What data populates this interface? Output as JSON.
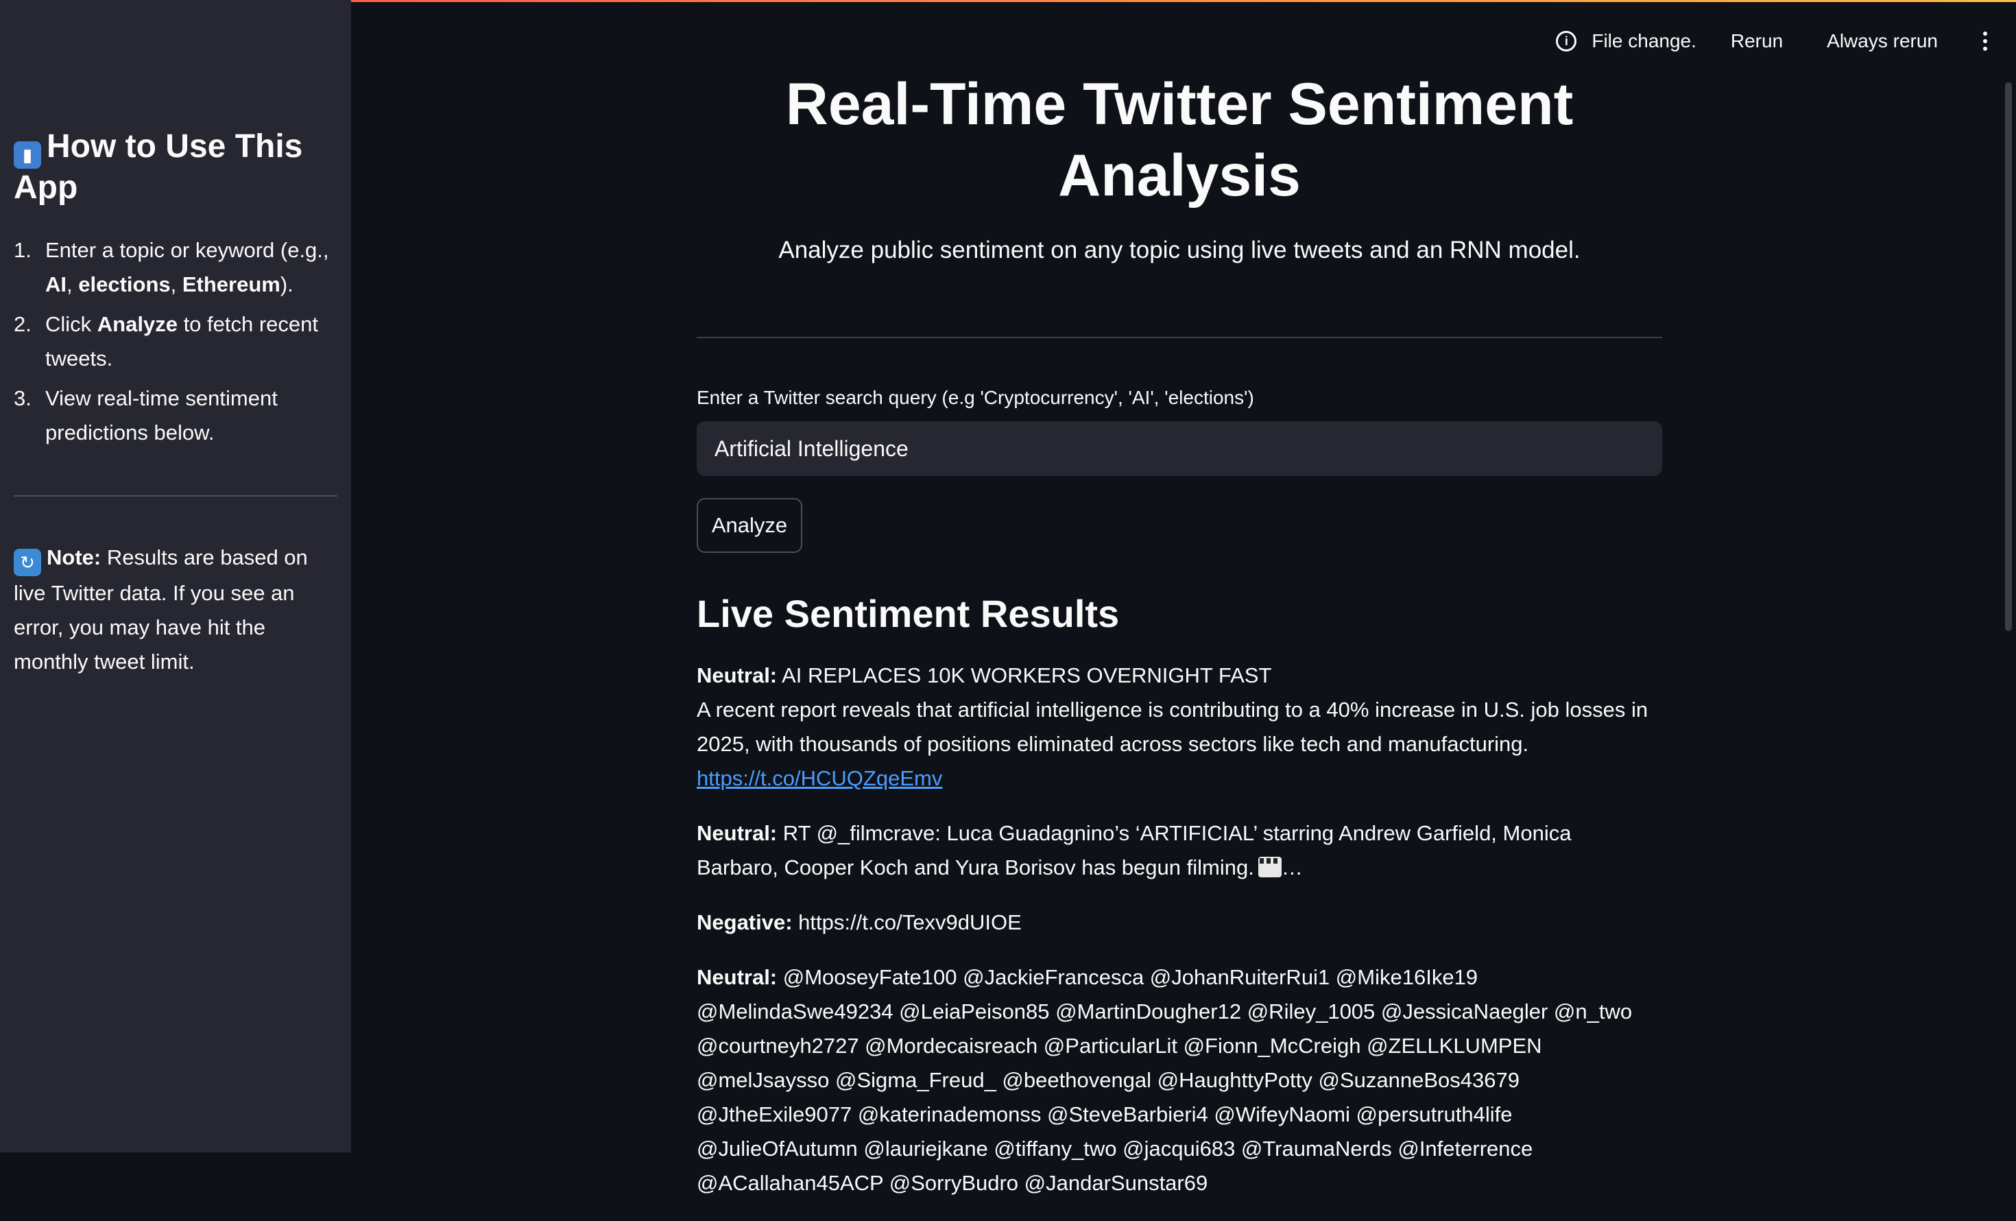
{
  "sidebar": {
    "heading": "How to Use This App",
    "heading_icon": "book-emoji",
    "steps": [
      {
        "num": "1.",
        "pre": "Enter a topic or keyword (e.g., ",
        "b1": "AI",
        "sep1": ", ",
        "b2": "elections",
        "sep2": ", ",
        "b3": "Ethereum",
        "post": ")."
      },
      {
        "num": "2.",
        "pre": "Click ",
        "bold": "Analyze",
        "post": " to fetch recent tweets."
      },
      {
        "num": "3.",
        "text": "View real-time sentiment predictions below."
      }
    ],
    "note_icon": "refresh-emoji",
    "note_label": "Note:",
    "note_text": " Results are based on live Twitter data. If you see an error, you may have hit the monthly tweet limit."
  },
  "toolbar": {
    "status": "File change.",
    "rerun": "Rerun",
    "always_rerun": "Always rerun"
  },
  "main": {
    "title": "Real-Time Twitter Sentiment Analysis",
    "subtitle": "Analyze public sentiment on any topic using live tweets and an RNN model.",
    "search_label": "Enter a Twitter search query (e.g 'Cryptocurrency', 'AI', 'elections')",
    "search_value": "Artificial Intelligence",
    "analyze_label": "Analyze",
    "results_heading": "Live Sentiment Results",
    "results": [
      {
        "label": "Neutral:",
        "text": " AI REPLACES 10K WORKERS OVERNIGHT FAST",
        "line2": "A recent report reveals that artificial intelligence is contributing to a 40% increase in U.S. job losses in 2025, with thousands of positions eliminated across sectors like tech and manufacturing.",
        "link": "https://t.co/HCUQZqeEmv"
      },
      {
        "label": "Neutral:",
        "text": " RT @_filmcrave: Luca Guadagnino’s ‘ARTIFICIAL’ starring Andrew Garfield, Monica Barbaro, Cooper Koch and Yura Borisov has begun filming.",
        "suffix": "…"
      },
      {
        "label": "Negative:",
        "text": " https://t.co/Texv9dUIOE"
      },
      {
        "label": "Neutral:",
        "text": " @MooseyFate100 @JackieFrancesca @JohanRuiterRui1 @Mike16Ike19 @MelindaSwe49234 @LeiaPeison85 @MartinDougher12 @Riley_1005 @JessicaNaegler @n_two @courtneyh2727 @Mordecaisreach @ParticularLit @Fionn_McCreigh @ZELLKLUMPEN @melJsaysso @Sigma_Freud_ @beethovengal @HaughttyPotty @SuzanneBos43679 @JtheExile9077 @katerinademonss @SteveBarbieri4 @WifeyNaomi @persutruth4life @JulieOfAutumn @lauriejkane @tiffany_two @jacqui683 @TraumaNerds @Infeterrence @ACallahan45ACP @SorryBudro @JandarSunstar69"
      }
    ]
  }
}
